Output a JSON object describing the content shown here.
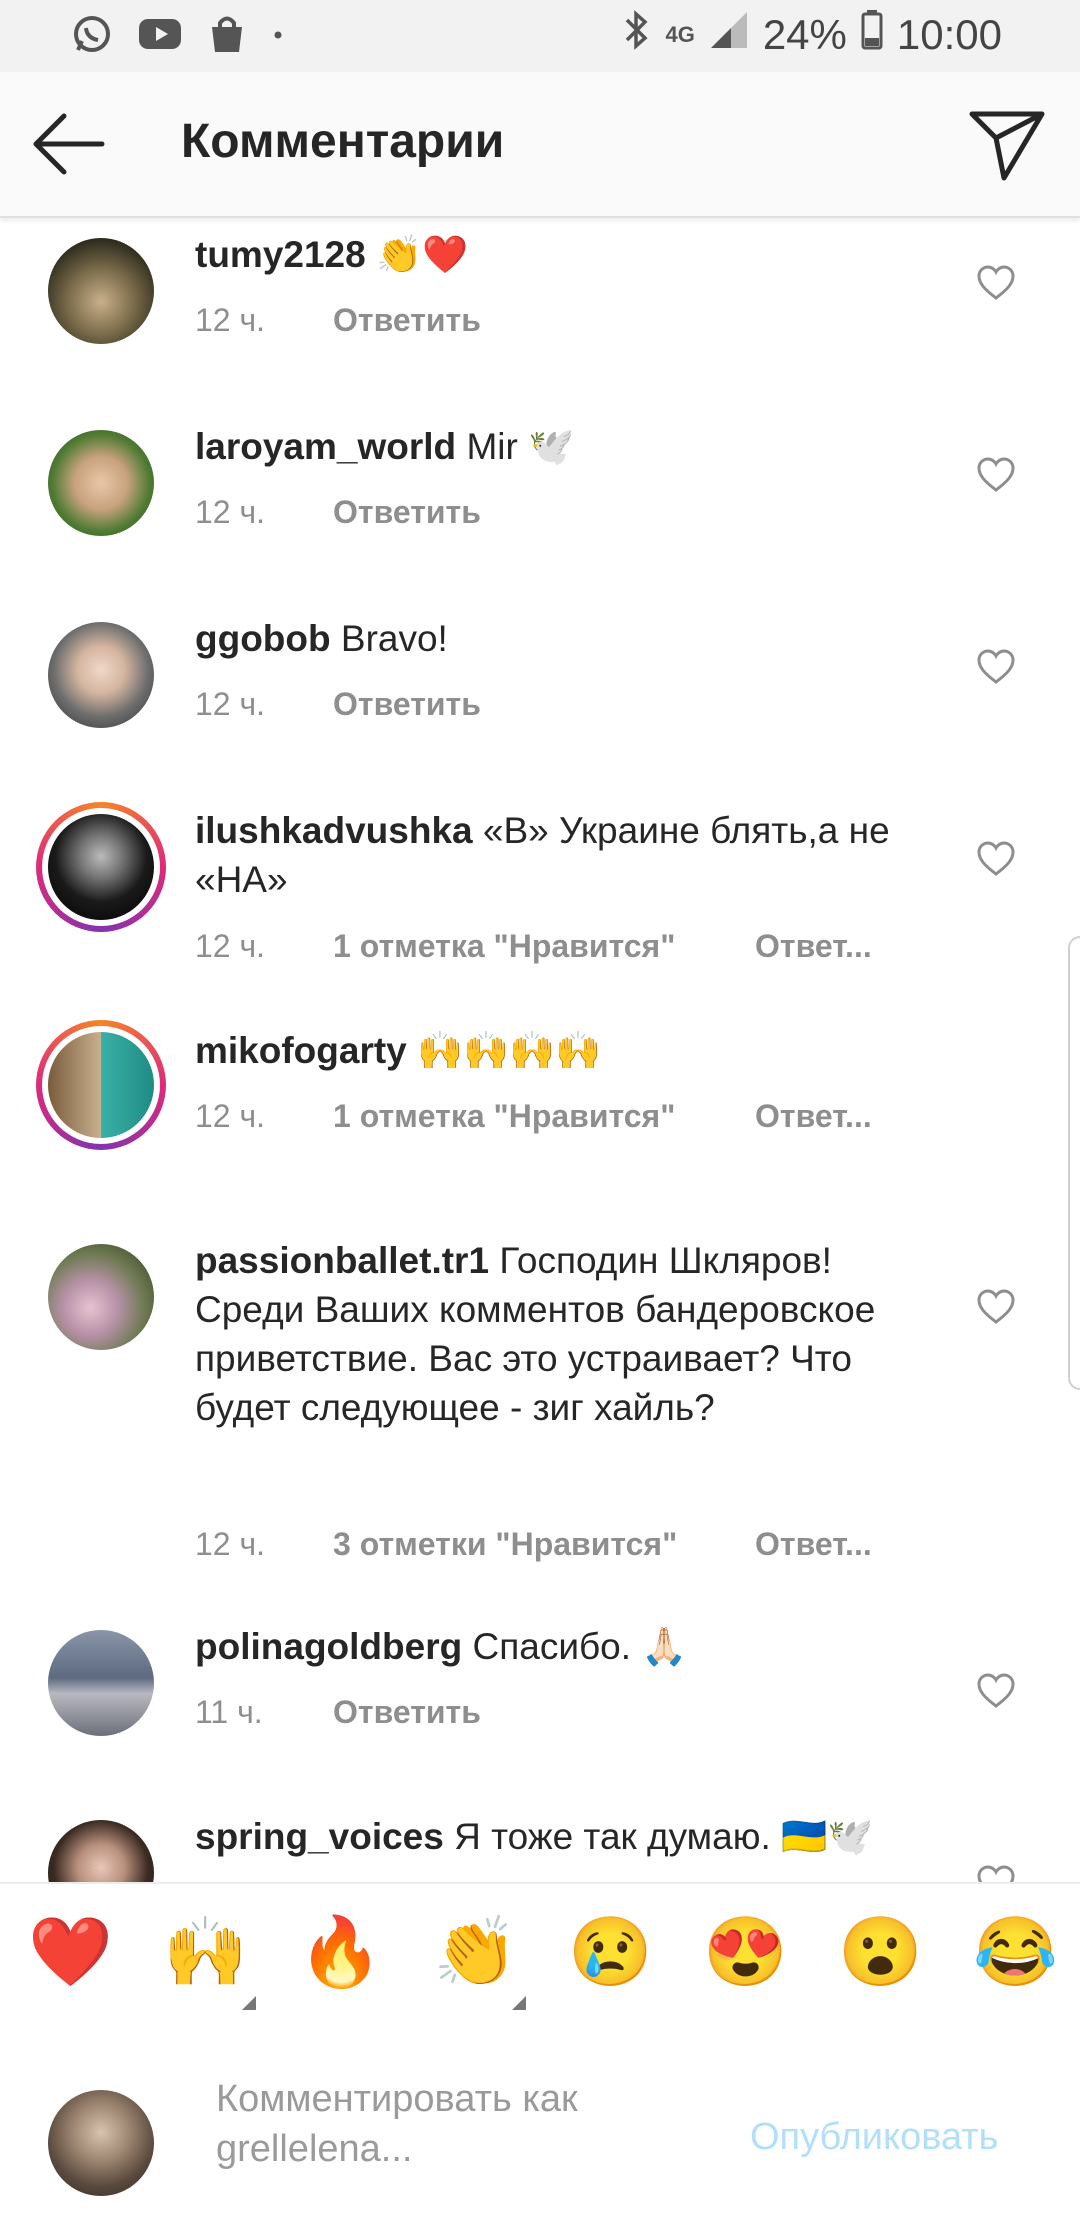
{
  "status": {
    "battery": "24%",
    "time": "10:00",
    "network": "4G"
  },
  "header": {
    "title": "Комментарии"
  },
  "comments": [
    {
      "user": "tumy2128",
      "text": "👏❤️",
      "time": "12 ч.",
      "likes": "",
      "reply": "Ответить"
    },
    {
      "user": "laroyam_world",
      "text": "Mir 🕊️",
      "time": "12 ч.",
      "likes": "",
      "reply": "Ответить"
    },
    {
      "user": "ggobob",
      "text": "Bravo!",
      "time": "12 ч.",
      "likes": "",
      "reply": "Ответить"
    },
    {
      "user": "ilushkadvushka",
      "text": "«В» Украине блять,а не «НА»",
      "time": "12 ч.",
      "likes": "1 отметка \"Нравится\"",
      "reply": "Ответ..."
    },
    {
      "user": "mikofogarty",
      "text": "🙌🙌🙌🙌",
      "time": "12 ч.",
      "likes": "1 отметка \"Нравится\"",
      "reply": "Ответ..."
    },
    {
      "user": "passionballet.tr1",
      "text": "Господин Шкляров! Среди Ваших комментов бандеровское приветствие. Вас это устраивает? Что будет следующее - зиг хайль?",
      "time": "12 ч.",
      "likes": "3 отметки \"Нравится\"",
      "reply": "Ответ..."
    },
    {
      "user": "polinagoldberg",
      "text": "Спасибо. 🙏🏻",
      "time": "11 ч.",
      "likes": "",
      "reply": "Ответить"
    },
    {
      "user": "spring_voices",
      "text": "Я тоже так думаю. 🇺🇦🕊️",
      "time": "",
      "likes": "",
      "reply": ""
    }
  ],
  "emoji_bar": [
    "❤️",
    "🙌",
    "🔥",
    "👏",
    "😢",
    "😍",
    "😮",
    "😂"
  ],
  "composer": {
    "placeholder": "Комментировать как grellelena...",
    "post_label": "Опубликовать"
  }
}
